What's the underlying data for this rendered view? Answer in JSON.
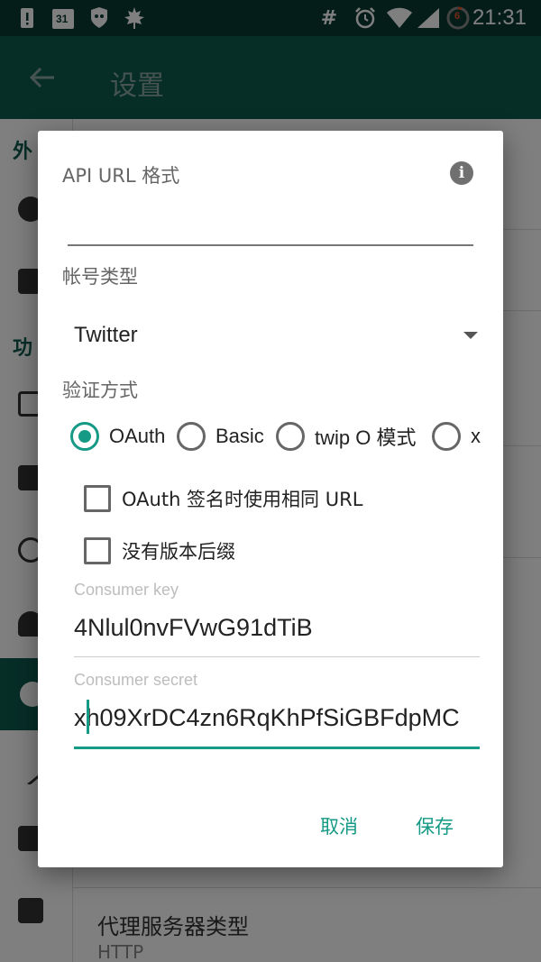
{
  "status_bar": {
    "time": "21:31",
    "calendar_day": "31",
    "hash_symbol": "#",
    "battery_level": "6",
    "icons": [
      "alert-icon",
      "calendar-icon",
      "shield-icon",
      "maple-leaf-icon",
      "hash-icon",
      "alarm-icon",
      "wifi-icon",
      "signal-icon",
      "battery-icon"
    ]
  },
  "app_bar": {
    "title": "设置"
  },
  "background": {
    "sections": [
      "外",
      "功"
    ],
    "item_title": "代理服务器类型",
    "item_subtitle": "HTTP"
  },
  "dialog": {
    "api_url_label": "API URL 格式",
    "api_url_value": "",
    "account_type_label": "帐号类型",
    "account_type_value": "Twitter",
    "auth_method_label": "验证方式",
    "auth_options": [
      {
        "label": "OAuth",
        "checked": true
      },
      {
        "label": "Basic",
        "checked": false
      },
      {
        "label": "twip O 模式",
        "checked": false
      },
      {
        "label": "x",
        "checked": false
      }
    ],
    "checkbox_same_url": {
      "label": "OAuth 签名时使用相同 URL",
      "checked": false
    },
    "checkbox_no_version_suffix": {
      "label": "没有版本后缀",
      "checked": false
    },
    "consumer_key_hint": "Consumer key",
    "consumer_key_value": "4Nlul0nvFVwG91dTiB",
    "consumer_secret_hint": "Consumer secret",
    "consumer_secret_value": "xh09XrDC4zn6RqKhPfSiGBFdpMC",
    "cancel_label": "取消",
    "save_label": "保存"
  },
  "colors": {
    "accent": "#159a86",
    "primary": "#0e5a4e",
    "status_bar": "#0a3a32"
  }
}
